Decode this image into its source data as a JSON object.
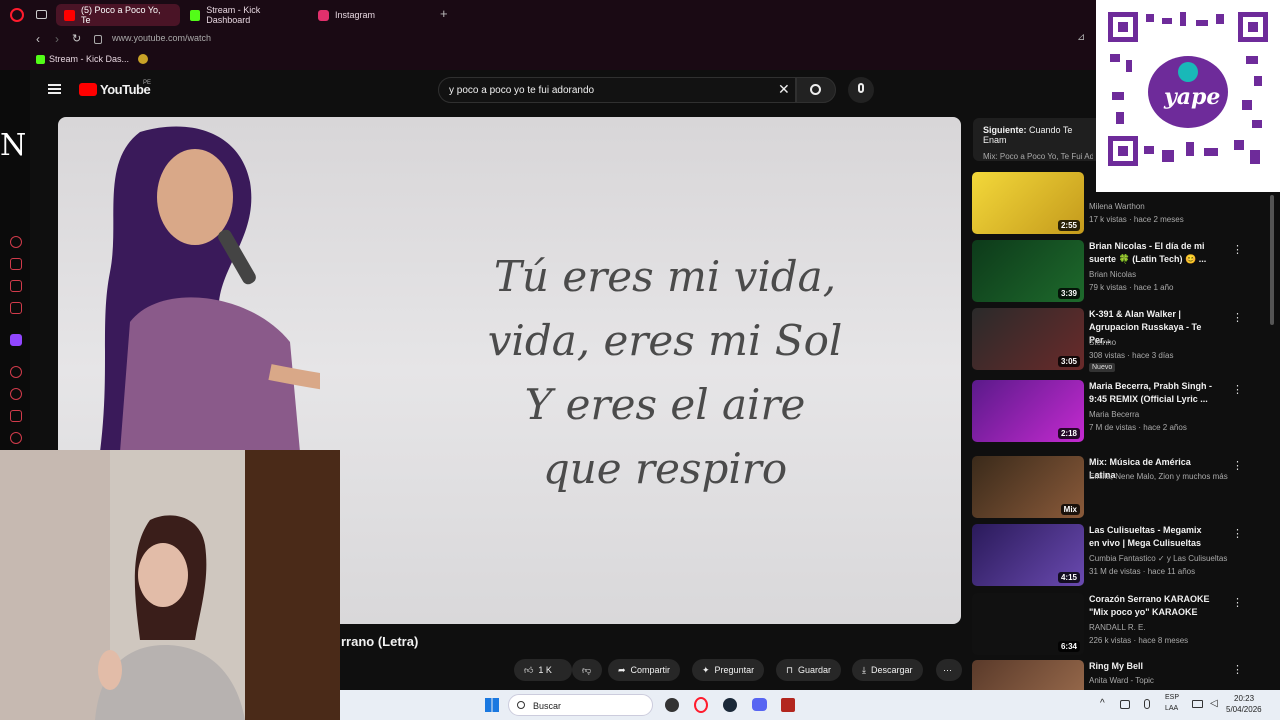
{
  "browser": {
    "tabs": [
      {
        "label": "(5) Poco a Poco Yo, Te",
        "color": "#ff0000"
      },
      {
        "label": "Stream - Kick Dashboard",
        "color": "#53fc18"
      },
      {
        "label": "Instagram",
        "color": "#e1306c"
      }
    ],
    "url": "www.youtube.com/watch",
    "bookmark": "Stream - Kick Das..."
  },
  "youtube": {
    "logo": "YouTube",
    "region": "PE",
    "search_query": "y poco a poco yo te fui adorando",
    "video_title_visible": "rrano (Letra)",
    "lyrics": [
      "Tú eres mi vida,",
      "vida, eres mi Sol",
      "Y eres el aire",
      "que respiro"
    ],
    "actions": {
      "like": "1 K",
      "share": "Compartir",
      "ask": "Preguntar",
      "save": "Guardar",
      "download": "Descargar"
    },
    "next_label": "Siguiente:",
    "next_title": "Cuando Te Enam",
    "next_mix": "Mix: Poco a Poco Yo, Te Fui Adora",
    "recommendations": [
      {
        "title": "",
        "channel": "Milena Warthon",
        "meta": "17 k vistas · hace 2 meses",
        "duration": "2:55",
        "badge": ""
      },
      {
        "title": "Brian Nicolas - El día de mi suerte 🍀 (Latin Tech) 😊 ...",
        "channel": "Brian Nicolas",
        "meta": "79 k vistas · hace 1 año",
        "duration": "3:39",
        "badge": ""
      },
      {
        "title": "K-391 & Alan Walker | Agrupacion Russkaya - Te Per...",
        "channel": "Steinho",
        "meta": "308 vistas · hace 3 días",
        "duration": "3:05",
        "badge": "Nuevo"
      },
      {
        "title": "Maria Becerra, Prabh Singh - 9:45 REMIX (Official Lyric ...",
        "channel": "Maria Becerra",
        "meta": "7 M de vistas · hace 2 años",
        "duration": "2:18",
        "badge": ""
      },
      {
        "title": "Mix: Música de América Latina",
        "channel": "Emilia, Nene Malo, Zion y muchos más",
        "meta": "",
        "duration": "Mix",
        "badge": ""
      },
      {
        "title": "Las Culisueltas - Megamix en vivo | Mega Culisueltas",
        "channel": "Cumbia Fantastico ✓ y Las Culisueltas",
        "meta": "31 M de vistas · hace 11 años",
        "duration": "4:15",
        "badge": ""
      },
      {
        "title": "Corazón Serrano KARAOKE \"Mix poco yo\" KARAOKE",
        "channel": "RANDALL R. E.",
        "meta": "226 k vistas · hace 8 meses",
        "duration": "6:34",
        "badge": ""
      },
      {
        "title": "Ring My Bell",
        "channel": "Anita Ward - Topic",
        "meta": "",
        "duration": "",
        "badge": ""
      }
    ]
  },
  "overlay": {
    "yape": "yape"
  },
  "taskbar": {
    "search": "Buscar",
    "lang1": "ESP",
    "lang2": "LAA",
    "time": "20:23",
    "date": "5/04/2026"
  }
}
